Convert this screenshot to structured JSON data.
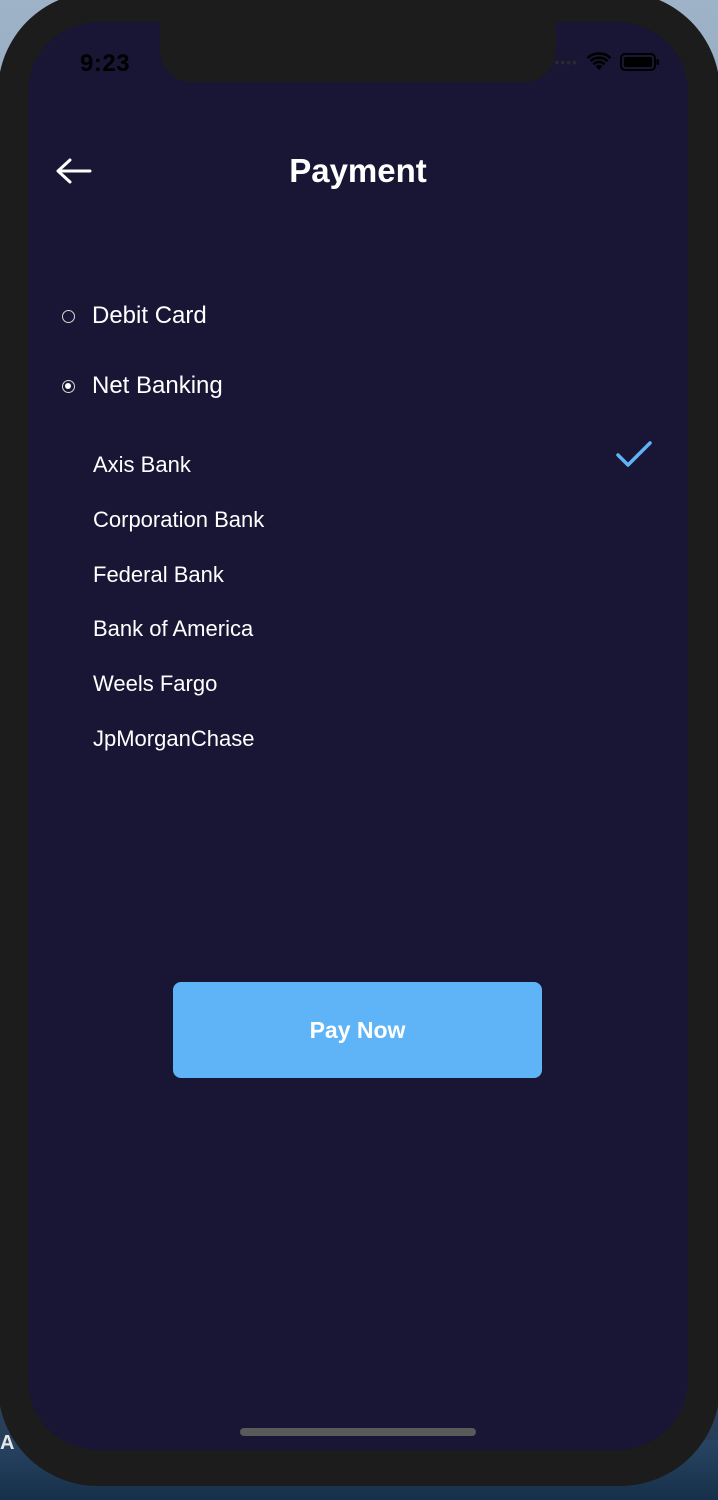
{
  "status_bar": {
    "time": "9:23",
    "signal_icon": "signal-dots-icon",
    "wifi_icon": "wifi-icon",
    "battery_icon": "battery-icon"
  },
  "header": {
    "back_icon": "arrow-left-icon",
    "title": "Payment"
  },
  "payment_options": [
    {
      "label": "Debit Card",
      "selected": false
    },
    {
      "label": "Net Banking",
      "selected": true
    }
  ],
  "banks": [
    {
      "label": "Axis Bank",
      "selected": true
    },
    {
      "label": "Corporation Bank",
      "selected": false
    },
    {
      "label": "Federal Bank",
      "selected": false
    },
    {
      "label": "Bank of America",
      "selected": false
    },
    {
      "label": "Weels Fargo",
      "selected": false
    },
    {
      "label": "JpMorganChase",
      "selected": false
    }
  ],
  "actions": {
    "pay_now_label": "Pay Now"
  },
  "colors": {
    "background": "#181634",
    "accent": "#5fb4f7",
    "text": "#ffffff",
    "frame": "#1c1c1c"
  },
  "backdrop": {
    "edge_text": "A"
  }
}
